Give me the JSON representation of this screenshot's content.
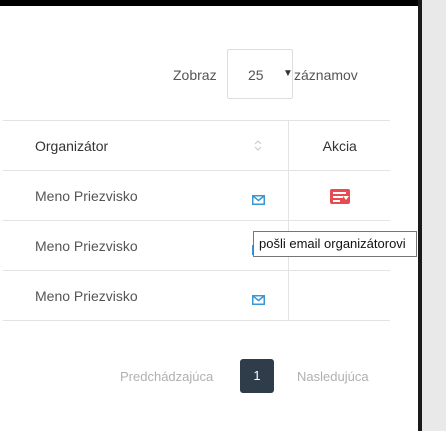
{
  "length_control": {
    "show_label": "Zobraz",
    "selected_value": "25",
    "records_label": "záznamov"
  },
  "table": {
    "headers": {
      "organizer": "Organizátor",
      "action": "Akcia"
    },
    "rows": [
      {
        "organizer": "Meno Priezvisko",
        "has_action_button": true
      },
      {
        "organizer": "Meno Priezvisko",
        "has_action_button": false
      },
      {
        "organizer": "Meno Priezvisko",
        "has_action_button": false
      }
    ]
  },
  "tooltip": {
    "text": "pošli email organizátorovi"
  },
  "pagination": {
    "previous": "Predchádzajúca",
    "current_page": "1",
    "next": "Nasledujúca"
  },
  "icons": {
    "email": "mail-icon",
    "sort": "sort-icon",
    "action": "list-dropdown-icon",
    "select_arrow": "caret-down-icon"
  },
  "colors": {
    "mail_icon": "#3a97d4",
    "action_button": "#e84a4f",
    "active_page": "#2f3d4a",
    "muted_text": "#b0b0b0"
  }
}
